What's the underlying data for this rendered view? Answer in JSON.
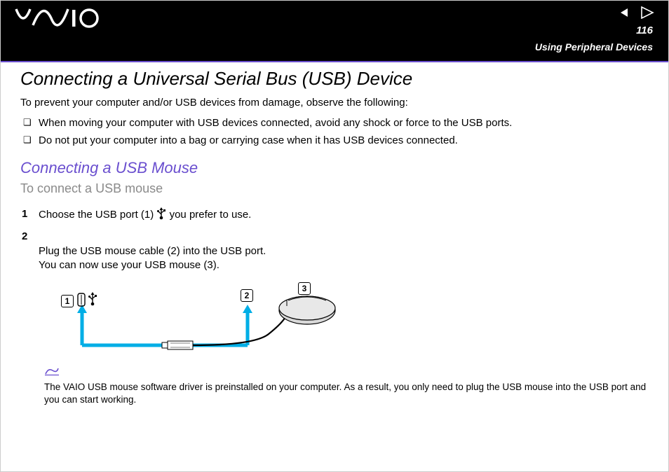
{
  "header": {
    "logo_text": "VAIO",
    "page_number": "116",
    "section": "Using Peripheral Devices"
  },
  "h1": "Connecting a Universal Serial Bus (USB) Device",
  "intro": "To prevent your computer and/or USB devices from damage, observe the following:",
  "bullets": [
    "When moving your computer with USB devices connected, avoid any shock or force to the USB ports.",
    "Do not put your computer into a bag or carrying case when it has USB devices connected."
  ],
  "h2": "Connecting a USB Mouse",
  "subhead": "To connect a USB mouse",
  "steps": [
    {
      "pre": "Choose the USB port (1) ",
      "post": " you prefer to use."
    },
    {
      "pre": "Plug the USB mouse cable (2) into the USB port.\nYou can now use your USB mouse (3).",
      "post": ""
    }
  ],
  "callouts": {
    "c1": "1",
    "c2": "2",
    "c3": "3"
  },
  "note": "The VAIO USB mouse software driver is preinstalled on your computer. As a result, you only need to plug the USB mouse into the USB port and you can start working."
}
